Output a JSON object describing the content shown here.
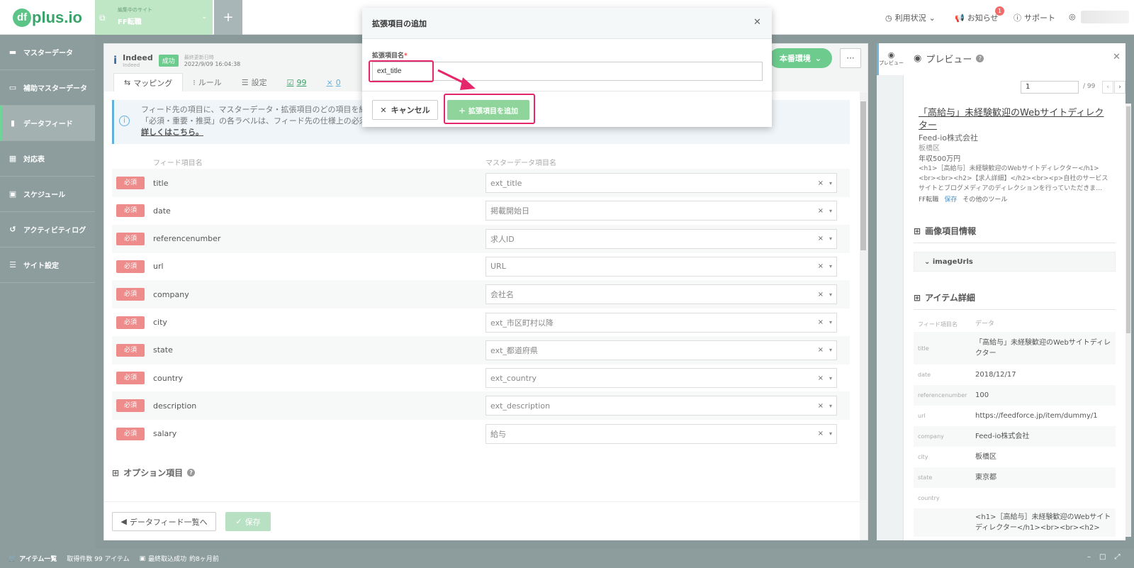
{
  "app": {
    "logo": "plus.io",
    "logo_mark": "df"
  },
  "site": {
    "label": "編集中のサイト",
    "name": "FF転職"
  },
  "header": {
    "usage": "利用状況",
    "notices": "お知らせ",
    "notice_count": "1",
    "support": "サポート"
  },
  "sidebar": {
    "items": [
      {
        "label": "マスターデータ",
        "icon": "database-icon"
      },
      {
        "label": "補助マスターデータ",
        "icon": "folder-icon"
      },
      {
        "label": "データフィード",
        "icon": "file-icon"
      },
      {
        "label": "対応表",
        "icon": "table-icon"
      },
      {
        "label": "スケジュール",
        "icon": "calendar-icon"
      },
      {
        "label": "アクティビティログ",
        "icon": "history-icon"
      },
      {
        "label": "サイト設定",
        "icon": "sliders-icon"
      }
    ]
  },
  "feed": {
    "name": "Indeed",
    "sub": "Indeed",
    "status": "成功",
    "updated_label": "最終更新日時",
    "updated": "2022/9/09 16:04:38"
  },
  "tabs": {
    "mapping": "マッピング",
    "rule": "ルール",
    "settings": "設定",
    "count1": "99",
    "count2": "0"
  },
  "info": {
    "line1": "フィード先の項目に、マスターデータ・拡張項目のどの項目を紐付",
    "line2": "「必須・重要・推奨」の各ラベルは、フィード先の仕様上の必須項",
    "link": "詳しくはこちら。"
  },
  "columns": {
    "feed": "フィード項目名",
    "master": "マスターデータ項目名"
  },
  "required_label": "必須",
  "mappings": [
    {
      "field": "title",
      "value": "ext_title"
    },
    {
      "field": "date",
      "value": "掲載開始日"
    },
    {
      "field": "referencenumber",
      "value": "求人ID"
    },
    {
      "field": "url",
      "value": "URL"
    },
    {
      "field": "company",
      "value": "会社名"
    },
    {
      "field": "city",
      "value": "ext_市区町村以降"
    },
    {
      "field": "state",
      "value": "ext_都道府県"
    },
    {
      "field": "country",
      "value": "ext_country"
    },
    {
      "field": "description",
      "value": "ext_description"
    },
    {
      "field": "salary",
      "value": "給与"
    }
  ],
  "options_label": "オプション項目",
  "buttons": {
    "back": "データフィード一覧へ",
    "save": "保存",
    "env": "本番環境",
    "more": "···"
  },
  "preview": {
    "strip_label": "プレビュー",
    "title": "プレビュー",
    "page": "1",
    "total": "/ 99",
    "job_title": "「高給与」未経験歓迎のWebサイトディレクター",
    "company": "Feed-io株式会社",
    "city": "板橋区",
    "salary": "年収500万円",
    "desc": "<h1>［高給与］未経験歓迎のWebサイトディレクター</h1><br><br><h2>【求人詳細】</h2><br><p>自社のサービスサイトとブログメディアのディレクションを行っていただきま…",
    "link1": "FF転職",
    "link2": "保存",
    "link3": "その他のツール",
    "image_section": "画像項目情報",
    "image_urls": "imageUrls",
    "detail_section": "アイテム詳細",
    "detail_head_key": "フィード項目名",
    "detail_head_val": "データ",
    "details": [
      {
        "key": "title",
        "val": "「高給与」未経験歓迎のWebサイトディレクター"
      },
      {
        "key": "date",
        "val": "2018/12/17"
      },
      {
        "key": "referencenumber",
        "val": "100"
      },
      {
        "key": "url",
        "val": "https://feedforce.jp/item/dummy/1"
      },
      {
        "key": "company",
        "val": "Feed-io株式会社"
      },
      {
        "key": "city",
        "val": "板橋区"
      },
      {
        "key": "state",
        "val": "東京都"
      },
      {
        "key": "country",
        "val": ""
      },
      {
        "key": "",
        "val": "<h1>［高給与］未経験歓迎のWebサイトディレクター</h1><br><br><h2>"
      }
    ]
  },
  "statusbar": {
    "items_label": "アイテム一覧",
    "count": "取得件数 99 アイテム",
    "last_label": "最終取込成功",
    "last": "約8ヶ月前"
  },
  "modal": {
    "title": "拡張項目の追加",
    "field_label": "拡張項目名",
    "required_mark": "*",
    "input_value": "ext_title",
    "cancel": "キャンセル",
    "add": "拡張項目を追加"
  },
  "colors": {
    "accent": "#6ccb8d",
    "highlight": "#e6266a",
    "required": "#ee8b8b"
  }
}
